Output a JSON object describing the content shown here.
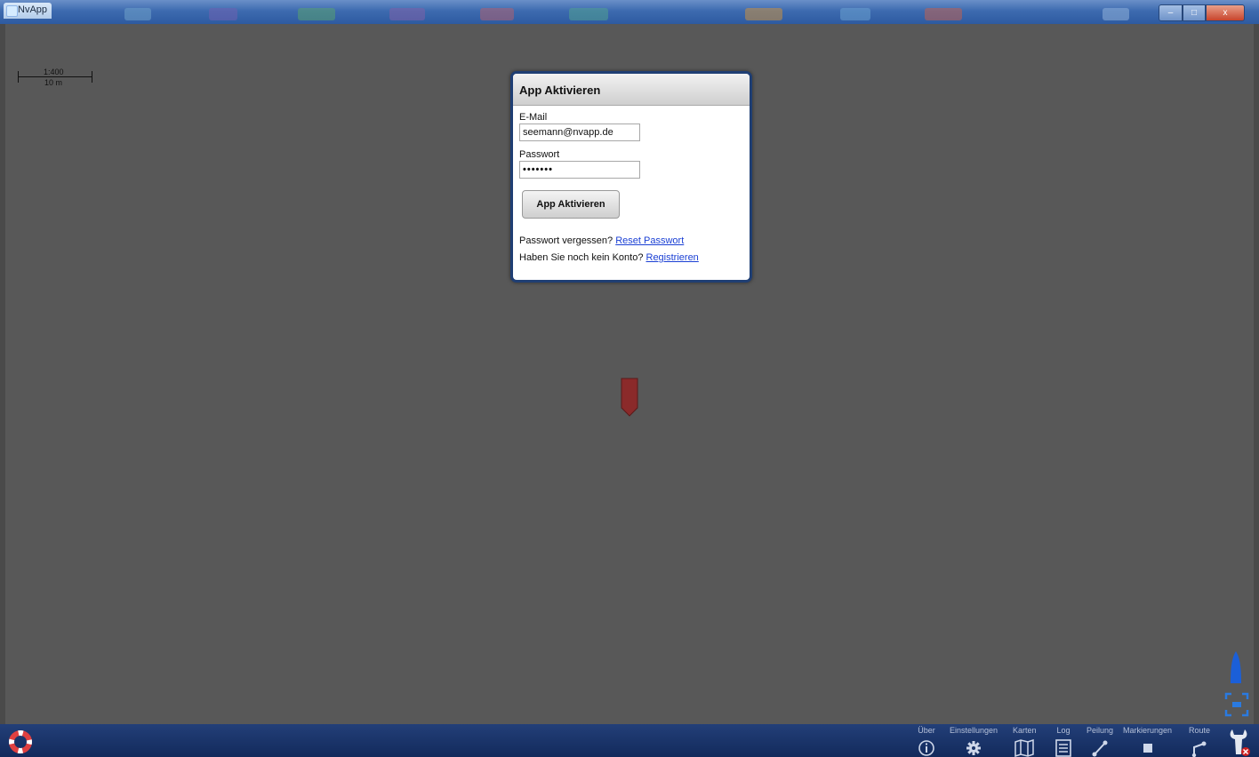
{
  "window": {
    "title": "NvApp",
    "controls": {
      "minimize": "–",
      "maximize": "□",
      "close": "x"
    }
  },
  "map": {
    "scale_ratio": "1:400",
    "scale_distance": "10 m"
  },
  "dialog": {
    "title": "App Aktivieren",
    "email_label": "E-Mail",
    "email_value": "seemann@nvapp.de",
    "password_label": "Passwort",
    "password_masked": "•••••••",
    "submit_label": "App Aktivieren",
    "forgot_text": "Passwort vergessen?",
    "forgot_link": "Reset Passwort",
    "register_text": "Haben Sie noch kein Konto?",
    "register_link": "Registrieren"
  },
  "toolbar": {
    "items": [
      {
        "label": "Über",
        "icon": "info-icon"
      },
      {
        "label": "Einstellungen",
        "icon": "gear-icon"
      },
      {
        "label": "Karten",
        "icon": "map-icon"
      },
      {
        "label": "Log",
        "icon": "log-icon"
      },
      {
        "label": "Peilung",
        "icon": "bearing-icon"
      },
      {
        "label": "Markierungen",
        "icon": "marker-icon"
      },
      {
        "label": "Route",
        "icon": "route-icon"
      }
    ]
  },
  "colors": {
    "toolbar": "#1a3468",
    "dialog_border": "#1f3e73",
    "link": "#1a3fd4",
    "boat_marker": "#8b2a2a"
  }
}
